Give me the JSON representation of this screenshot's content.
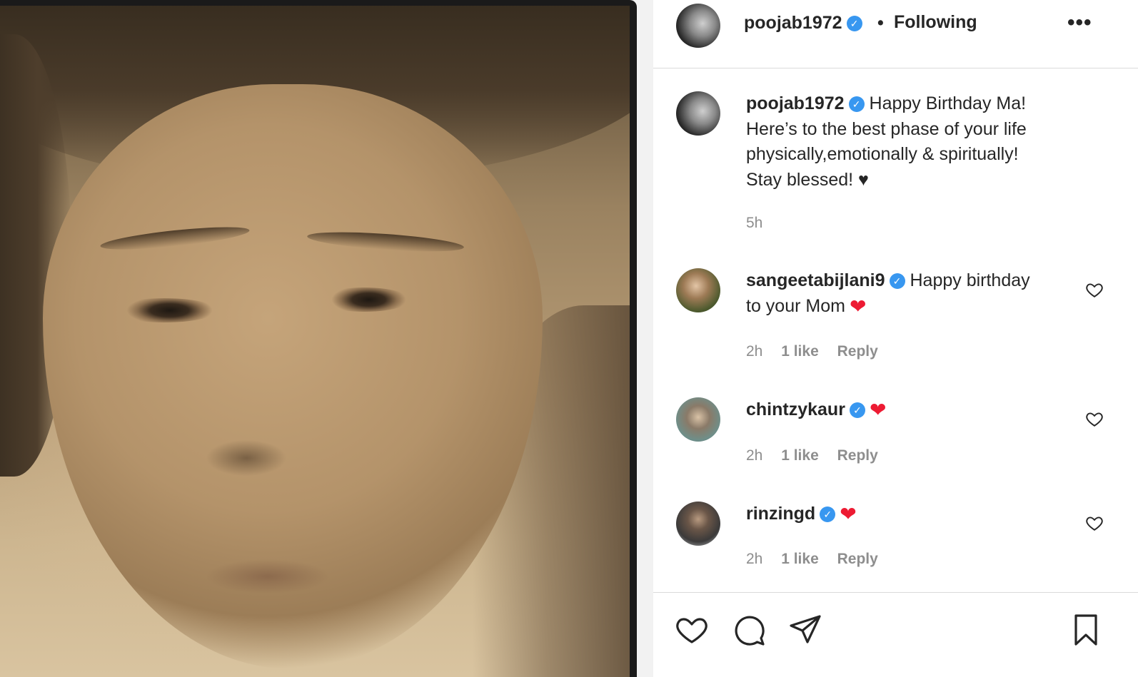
{
  "post": {
    "author": "poojab1972",
    "follow_status": "Following",
    "more_label": "•••"
  },
  "caption": {
    "user": "poojab1972",
    "text_lines": [
      "Happy Birthday Ma!",
      "Here’s to the best phase of your life",
      "physically,emotionally & spiritually!",
      "Stay blessed! ♥"
    ],
    "time": "5h"
  },
  "comments": [
    {
      "user": "sangeetabijlani9",
      "text_line1": "Happy birthday",
      "text_line2": "to your Mom",
      "time": "2h",
      "likes": "1 like",
      "reply": "Reply"
    },
    {
      "user": "chintzykaur",
      "time": "2h",
      "likes": "1 like",
      "reply": "Reply"
    },
    {
      "user": "rinzingd",
      "time": "2h",
      "likes": "1 like",
      "reply": "Reply"
    }
  ],
  "colors": {
    "verified": "#3897f0",
    "heart": "#ed1b33",
    "muted_text": "#8e8e8e",
    "divider": "#dbdbdb"
  },
  "icons": [
    "verified-badge-icon",
    "more-options-icon",
    "heart-outline-icon",
    "comment-icon",
    "share-icon",
    "bookmark-icon",
    "red-heart-emoji-icon"
  ]
}
